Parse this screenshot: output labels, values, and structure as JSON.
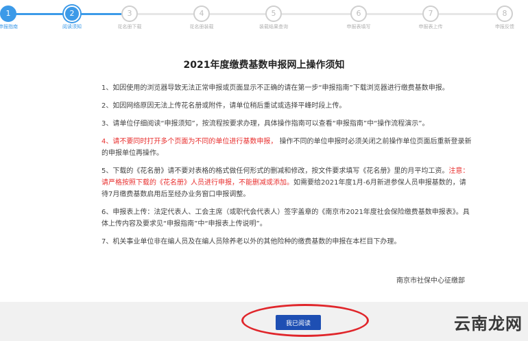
{
  "steps": [
    {
      "number": "1",
      "label": "申报指南",
      "state": "done"
    },
    {
      "number": "2",
      "label": "阅读须知",
      "state": "current"
    },
    {
      "number": "3",
      "label": "花名册下载",
      "state": "todo"
    },
    {
      "number": "4",
      "label": "花名册装载",
      "state": "todo"
    },
    {
      "number": "5",
      "label": "装载结果查询",
      "state": "todo"
    },
    {
      "number": "6",
      "label": "申报表填写",
      "state": "todo"
    },
    {
      "number": "7",
      "label": "申报表上传",
      "state": "todo"
    },
    {
      "number": "8",
      "label": "申报反馈",
      "state": "todo"
    }
  ],
  "notice": {
    "title": "2021年度缴费基数申报网上操作须知",
    "item1": "1、如因使用的浏览器导致无法正常申报或页面显示不正确的请在第一步“申报指南”下载浏览器进行缴费基数申报。",
    "item2": "2、如因网络原因无法上传花名册或附件，请单位稍后重试或选择平峰时段上传。",
    "item3": "3、请单位仔细阅读“申报须知”，按流程按要求办理，具体操作指南可以查看“申报指南”中“操作流程演示”。",
    "item4_red": "4、请不要同时打开多个页面为不同的单位进行基数申报，",
    "item4_rest": "操作不同的单位申报时必须关闭之前操作单位页面后重新登录新的申报单位再操作。",
    "item5_a": "5、下载的《花名册》请不要对表格的格式做任何形式的删减和修改，按文件要求填写《花名册》里的月平均工资。",
    "item5_red": "注意：请严格按照下载的《花名册》人员进行申报，不能删减或添加。",
    "item5_b": "如需要给2021年度1月-6月新进参保人员申报基数的，请待7月缴费基数启用后至经办业务窗口申报调整。",
    "item6": "6、申报表上传：法定代表人、工会主席（或职代会代表人）签字盖章的《南京市2021年度社会保险缴费基数申报表》。具体上传内容及要求见“申报指南”中“申报表上传说明”。",
    "item7": "7、机关事业单位非在编人员及在编人员除养老以外的其他险种的缴费基数的申报在本栏目下办理。",
    "signature": "南京市社保中心征缴部"
  },
  "footer": {
    "read_button": "我已阅读",
    "watermark": "云南龙网"
  },
  "colors": {
    "accent": "#3c9ae8",
    "button": "#1e4fb3",
    "alert": "#e8302f",
    "highlight_ring": "#e0262b"
  }
}
